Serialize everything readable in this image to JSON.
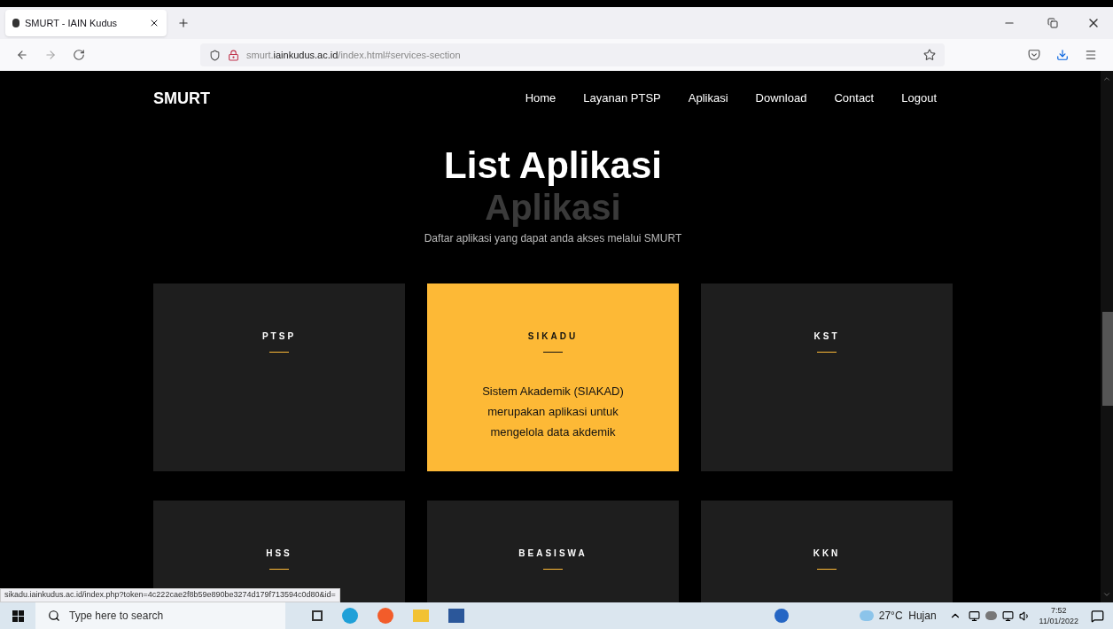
{
  "browser": {
    "tab": {
      "title": "SMURT - IAIN Kudus"
    },
    "url": {
      "host_prefix": "smurt.",
      "host": "iainkudus.ac.id",
      "path": "/index.html#services-section"
    }
  },
  "navbar": {
    "brand": "SMURT",
    "links": [
      {
        "label": "Home"
      },
      {
        "label": "Layanan PTSP"
      },
      {
        "label": "Aplikasi"
      },
      {
        "label": "Download"
      },
      {
        "label": "Contact"
      },
      {
        "label": "Logout"
      }
    ]
  },
  "section": {
    "background_word": "Aplikasi",
    "title": "List Aplikasi",
    "subtitle": "Daftar aplikasi yang dapat anda akses melalui SMURT"
  },
  "cards": [
    {
      "title": "PTSP",
      "highlighted": false
    },
    {
      "title": "SIKADU",
      "highlighted": true,
      "description": "Sistem Akademik (SIAKAD) merupakan aplikasi untuk mengelola data akdemik"
    },
    {
      "title": "KST",
      "highlighted": false
    },
    {
      "title": "HSS",
      "highlighted": false
    },
    {
      "title": "BEASISWA",
      "highlighted": false
    },
    {
      "title": "KKN",
      "highlighted": false
    }
  ],
  "status_url": "sikadu.iainkudus.ac.id/index.php?token=4c222cae2f8b59e890be3274d179f713594c0d80&id=",
  "taskbar": {
    "search_placeholder": "Type here to search",
    "weather": "27°C  Hujan",
    "time": "7:52",
    "date": "11/01/2022"
  }
}
